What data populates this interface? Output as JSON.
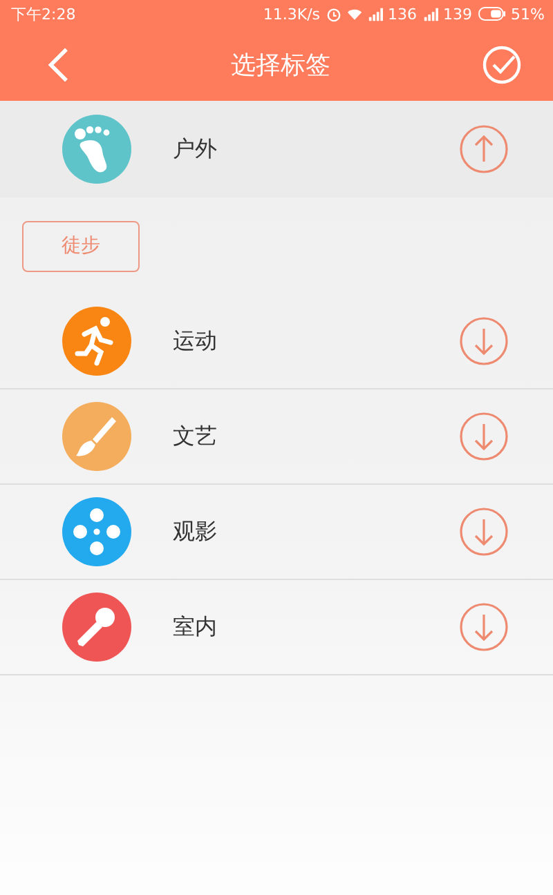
{
  "status_bar": {
    "time": "下午2:28",
    "speed": "11.3K/s",
    "signal_1": "136",
    "signal_2": "139",
    "battery": "51%"
  },
  "header": {
    "title": "选择标签"
  },
  "categories": [
    {
      "label": "户外",
      "kind": "foot",
      "color": "#5ec4c9",
      "expanded": true,
      "tags": [
        "徒步"
      ]
    },
    {
      "label": "运动",
      "kind": "runner",
      "color": "#f98513",
      "expanded": false
    },
    {
      "label": "文艺",
      "kind": "brush",
      "color": "#f4ac5d",
      "expanded": false
    },
    {
      "label": "观影",
      "kind": "film",
      "color": "#23a9ee",
      "expanded": false
    },
    {
      "label": "室内",
      "kind": "mic",
      "color": "#f05555",
      "expanded": false
    }
  ]
}
